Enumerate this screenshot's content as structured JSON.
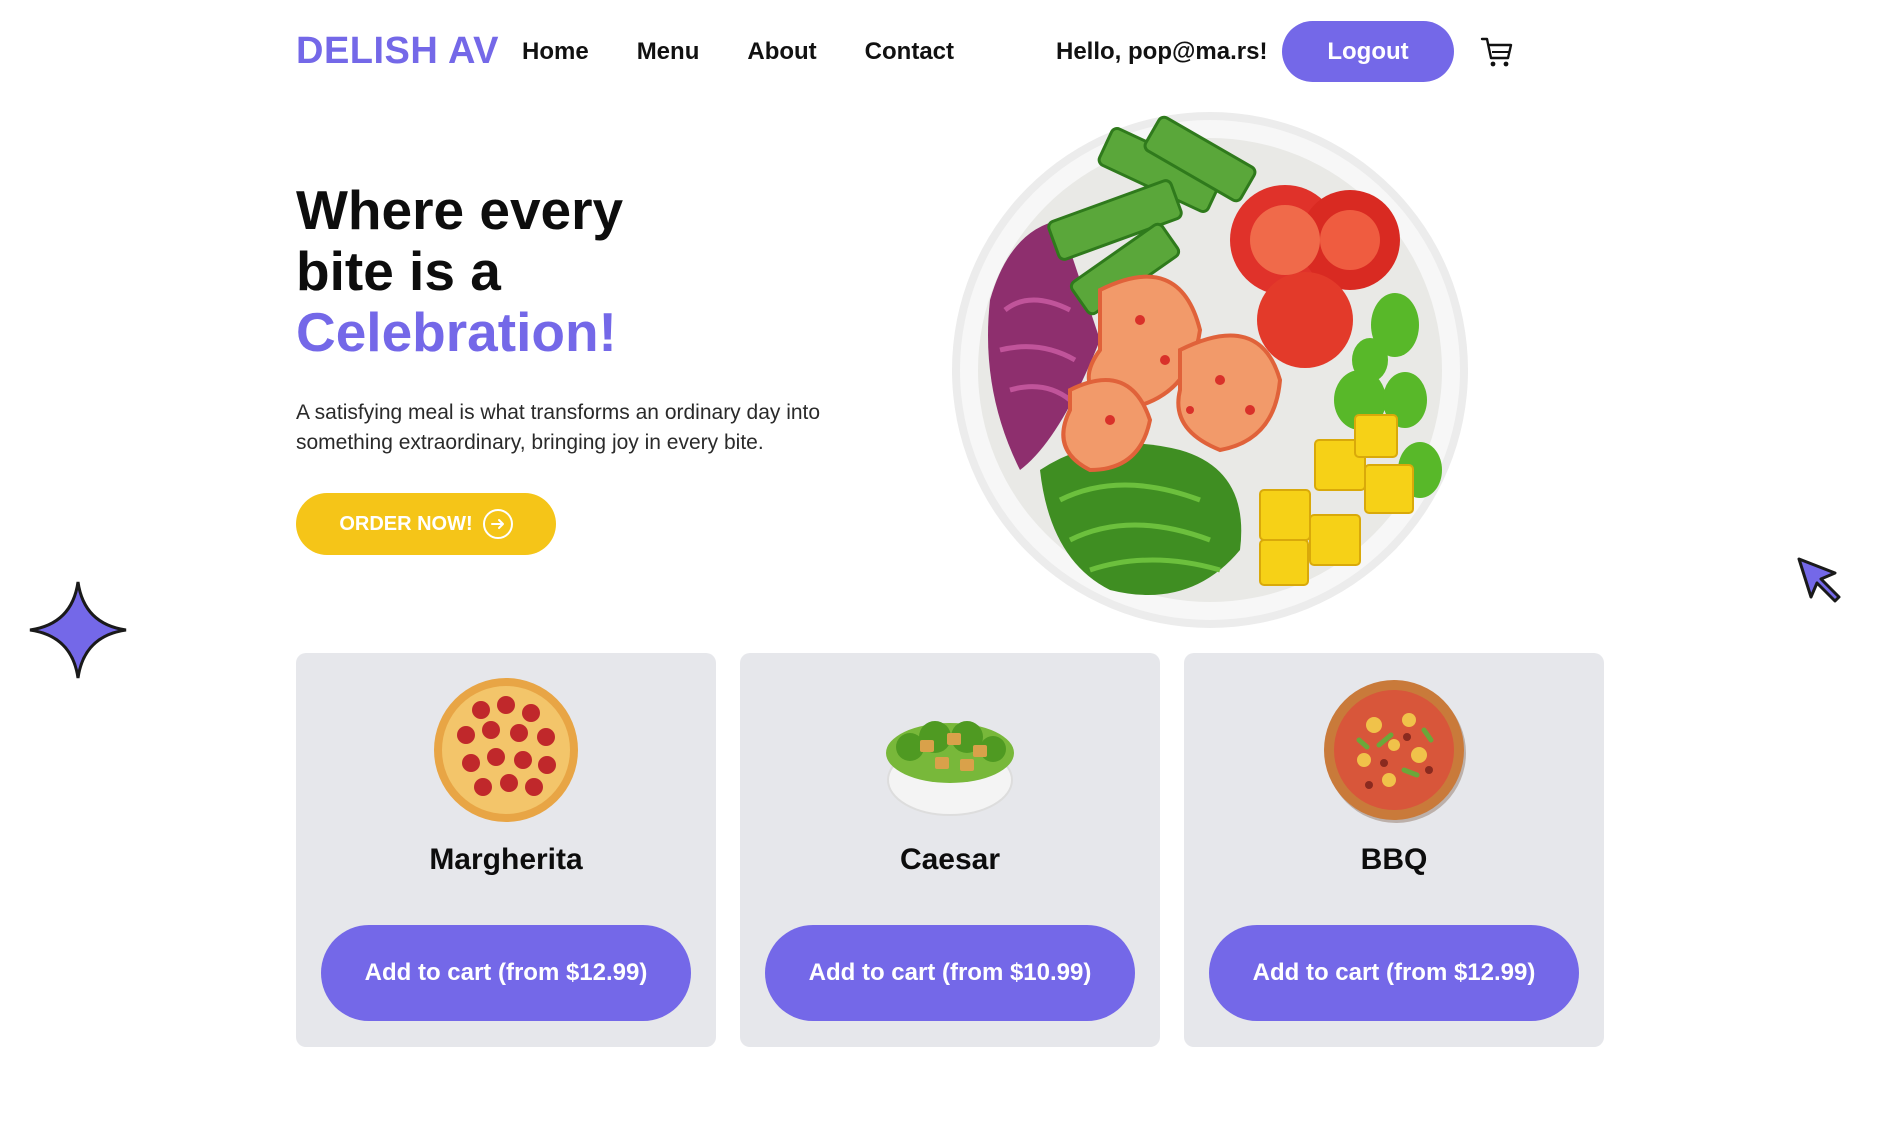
{
  "header": {
    "logo": "DELISH AV",
    "nav": [
      "Home",
      "Menu",
      "About",
      "Contact"
    ],
    "greeting": "Hello, pop@ma.rs!",
    "logout_label": "Logout"
  },
  "hero": {
    "title_line1": "Where every",
    "title_line2": "bite is a",
    "title_accent": "Celebration!",
    "description": "A satisfying meal is what transforms an ordinary day into something extraordinary, bringing joy in every bite.",
    "order_label": "ORDER NOW!"
  },
  "cards": [
    {
      "name": "Margherita",
      "button_label": "Add to cart (from $12.99)",
      "image": "pepperoni-pizza"
    },
    {
      "name": "Caesar",
      "button_label": "Add to cart (from $10.99)",
      "image": "caesar-salad"
    },
    {
      "name": "BBQ",
      "button_label": "Add to cart (from $12.99)",
      "image": "bbq-pizza"
    }
  ],
  "colors": {
    "accent": "#7468e8",
    "cta_yellow": "#f5c518",
    "card_bg": "#e6e7eb"
  }
}
